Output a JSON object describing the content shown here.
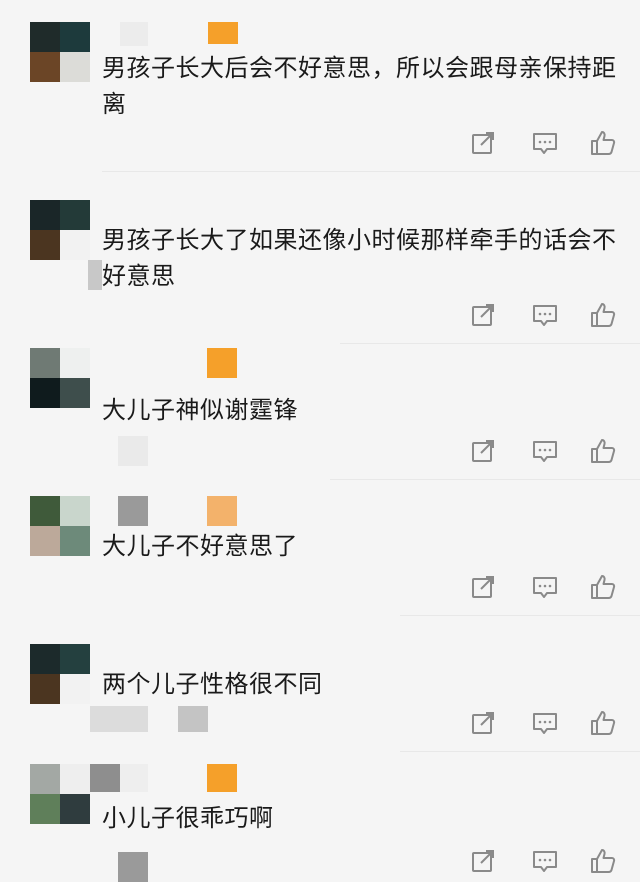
{
  "comments": [
    {
      "text": "男孩子长大后会不好意思，所以会跟母亲保持距离"
    },
    {
      "text": "男孩子长大了如果还像小时候那样牵手的话会不好意思"
    },
    {
      "text": "大儿子神似谢霆锋"
    },
    {
      "text": "大儿子不好意思了"
    },
    {
      "text": "两个儿子性格很不同"
    },
    {
      "text": "小儿子很乖巧啊"
    }
  ],
  "icons": {
    "share": "share-icon",
    "comment": "comment-icon",
    "like": "thumbs-up-icon"
  },
  "colors": {
    "background": "#f5f5f5",
    "text": "#1a1a1a",
    "icon": "#8a8a8a",
    "badge": "#f5a02a"
  }
}
